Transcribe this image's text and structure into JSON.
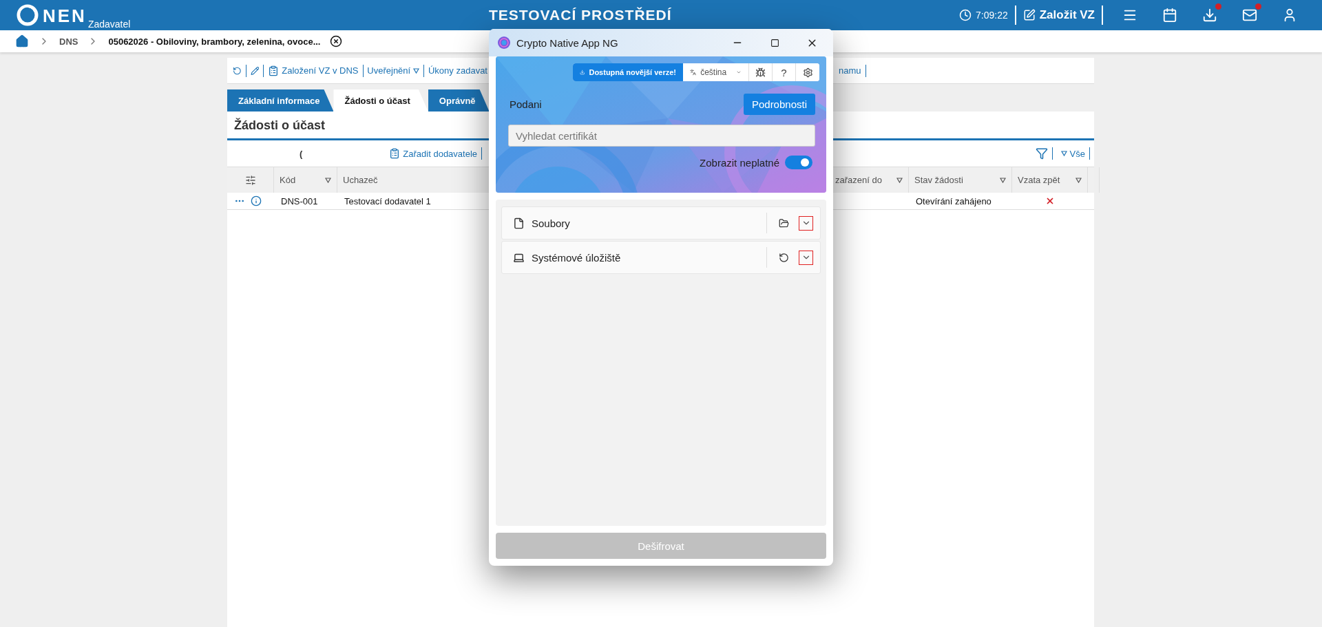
{
  "header": {
    "logo_text": "NEN",
    "logo_sub": "Zadavatel",
    "title": "TESTOVACÍ PROSTŘEDÍ",
    "time": "7:09:22",
    "create_label": "Založit VZ",
    "icons": [
      {
        "kind": "menu",
        "notification": false
      },
      {
        "kind": "calendar",
        "notification": false
      },
      {
        "kind": "download",
        "notification": true
      },
      {
        "kind": "mail",
        "notification": true
      },
      {
        "kind": "user",
        "notification": false
      }
    ]
  },
  "breadcrumb": {
    "items": [
      "DNS",
      "05062026 - Obiloviny, brambory, zelenina, ovoce..."
    ]
  },
  "toolbar": {
    "items": [
      {
        "kind": "refresh"
      },
      {
        "kind": "edit"
      },
      {
        "kind": "icon_link",
        "label": "Založení VZ v DNS"
      },
      {
        "kind": "dropdown",
        "label": "Uveřejnění"
      },
      {
        "kind": "link",
        "label": "Úkony zadavat"
      }
    ],
    "right_label": "namu"
  },
  "tabs": [
    {
      "label": "Základní informace",
      "selected": false
    },
    {
      "label": "Žádosti o účast",
      "selected": true
    },
    {
      "label": "Oprávně",
      "selected": false
    }
  ],
  "section": {
    "title": "Žádosti o účast",
    "paren": "(",
    "action": "Zařadit dodavatele",
    "filter_label": "Vše"
  },
  "table": {
    "columns": [
      {
        "label": "Kód",
        "kind": "sortable"
      },
      {
        "label": "Uchazeč",
        "kind": "plain"
      },
      {
        "label": "zařazení do",
        "kind": "sortable"
      },
      {
        "label": "Stav žádosti",
        "kind": "sortable"
      },
      {
        "label": "Vzata zpět",
        "kind": "sortable"
      }
    ],
    "rows": [
      {
        "code": "DNS-001",
        "bidder": "Testovací dodavatel 1",
        "status": "Otevírání zahájeno",
        "withdrawn": false
      }
    ]
  },
  "dialog": {
    "title": "Crypto Native App NG",
    "update_label": "Dostupná novější verze!",
    "language": "čeština",
    "help": "?",
    "profile": "Podani",
    "details_button": "Podrobnosti",
    "search": {
      "placeholder": "Vyhledat certifikát"
    },
    "toggle": {
      "label": "Zobrazit neplatné",
      "on": true
    },
    "stores": [
      {
        "kind": "files",
        "label": "Soubory",
        "highlighted": true
      },
      {
        "kind": "system",
        "label": "Systémové úložiště",
        "highlighted": true
      }
    ],
    "decrypt": {
      "label": "Dešifrovat",
      "disabled": true
    }
  }
}
